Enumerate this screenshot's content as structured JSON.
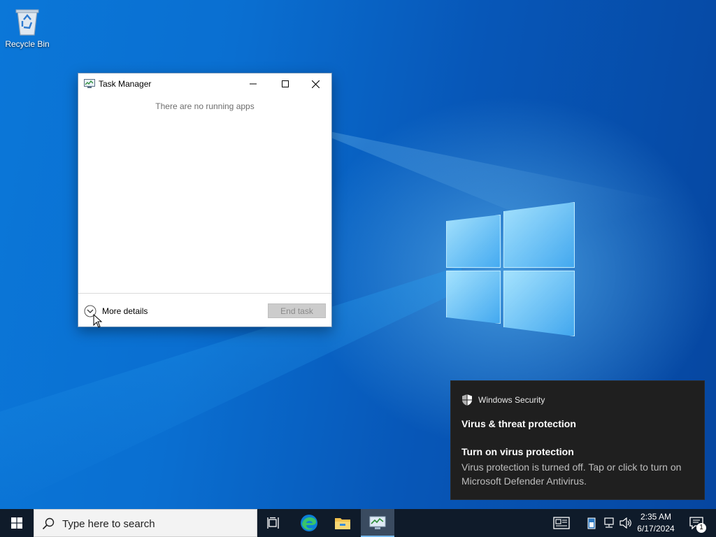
{
  "desktop": {
    "icons": [
      {
        "label": "Recycle Bin",
        "icon": "recycle-bin-icon"
      }
    ]
  },
  "task_manager": {
    "title": "Task Manager",
    "empty_message": "There are no running apps",
    "more_details_label": "More details",
    "end_task_label": "End task"
  },
  "toast": {
    "app_name": "Windows Security",
    "heading": "Virus & threat protection",
    "sub_heading": "Turn on virus protection",
    "body": "Virus protection is turned off. Tap or click to turn on Microsoft Defender Antivirus."
  },
  "taskbar": {
    "search_placeholder": "Type here to search",
    "apps": [
      "start-icon",
      "task-view-icon",
      "edge-icon",
      "file-explorer-icon",
      "task-manager-icon"
    ],
    "clock_time": "2:35 AM",
    "clock_date": "6/17/2024",
    "notification_count": "1"
  },
  "colors": {
    "accent": "#76b9ed",
    "taskbar_bg": "#0f1b2a",
    "toast_bg": "#1f1f1f",
    "wallpaper": "#0a63c6"
  }
}
